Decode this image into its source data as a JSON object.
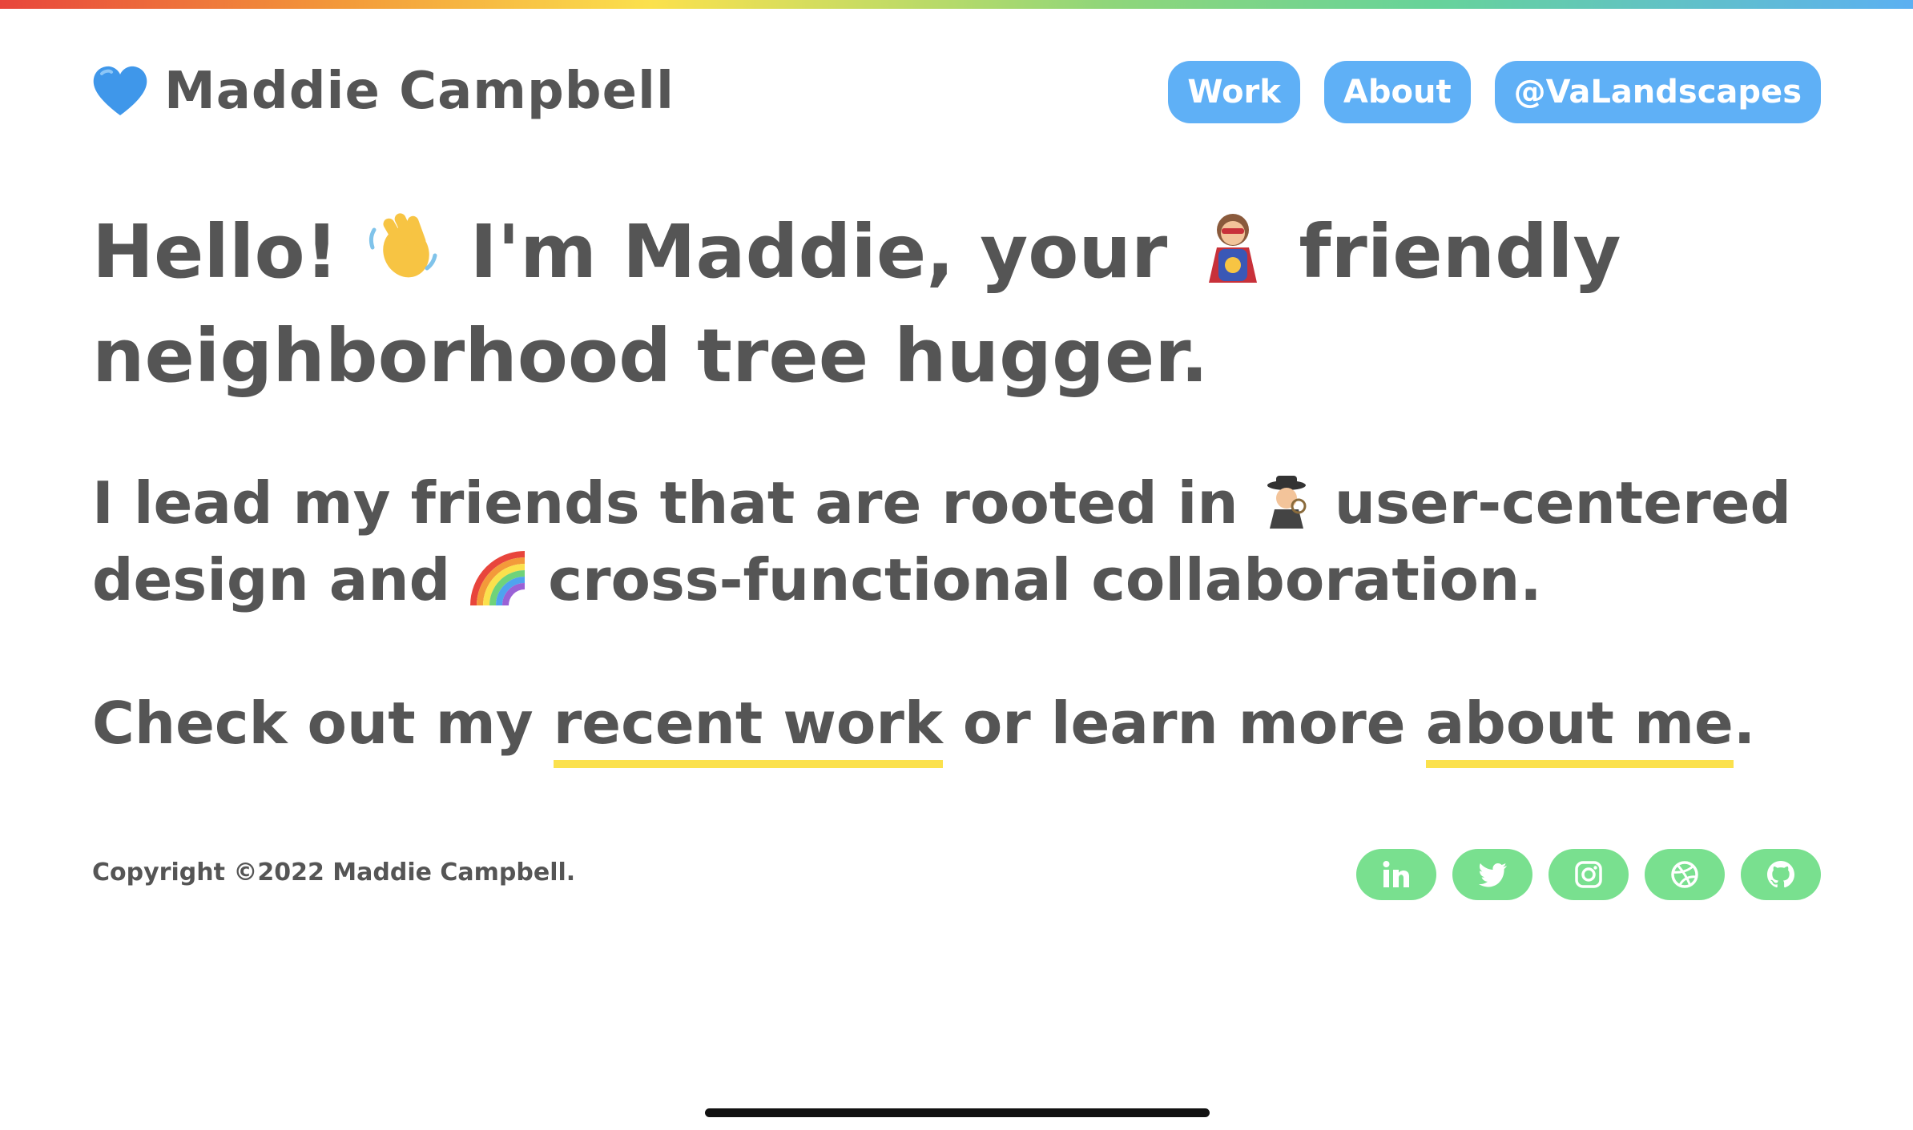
{
  "header": {
    "brand_name": "Maddie Campbell",
    "nav": [
      {
        "label": "Work"
      },
      {
        "label": "About"
      },
      {
        "label": "@VaLandscapes"
      }
    ]
  },
  "hero": {
    "part1": "Hello! ",
    "part2": " I'm Maddie, your ",
    "part3": " friendly neighborhood tree hugger."
  },
  "sub": {
    "part1": "I lead my friends that are rooted in ",
    "part2": " user-centered design and ",
    "part3": " cross-functional collaboration."
  },
  "cta": {
    "prefix": "Check out my ",
    "link1": "recent work",
    "middle": " or learn more ",
    "link2": "about me",
    "suffix": "."
  },
  "footer": {
    "copyright": "Copyright ©2022 Maddie Campbell."
  },
  "icons": {
    "brand": "blue-heart-icon",
    "hero_wave": "waving-hand-icon",
    "hero_superhero": "superhero-icon",
    "sub_detective": "detective-icon",
    "sub_rainbow": "rainbow-icon",
    "socials": [
      "linkedin-icon",
      "twitter-icon",
      "instagram-icon",
      "dribbble-icon",
      "github-icon"
    ]
  },
  "colors": {
    "text": "#555555",
    "nav_button": "#5fb0f6",
    "social_button": "#79e08f",
    "underline": "#fbe14d"
  }
}
